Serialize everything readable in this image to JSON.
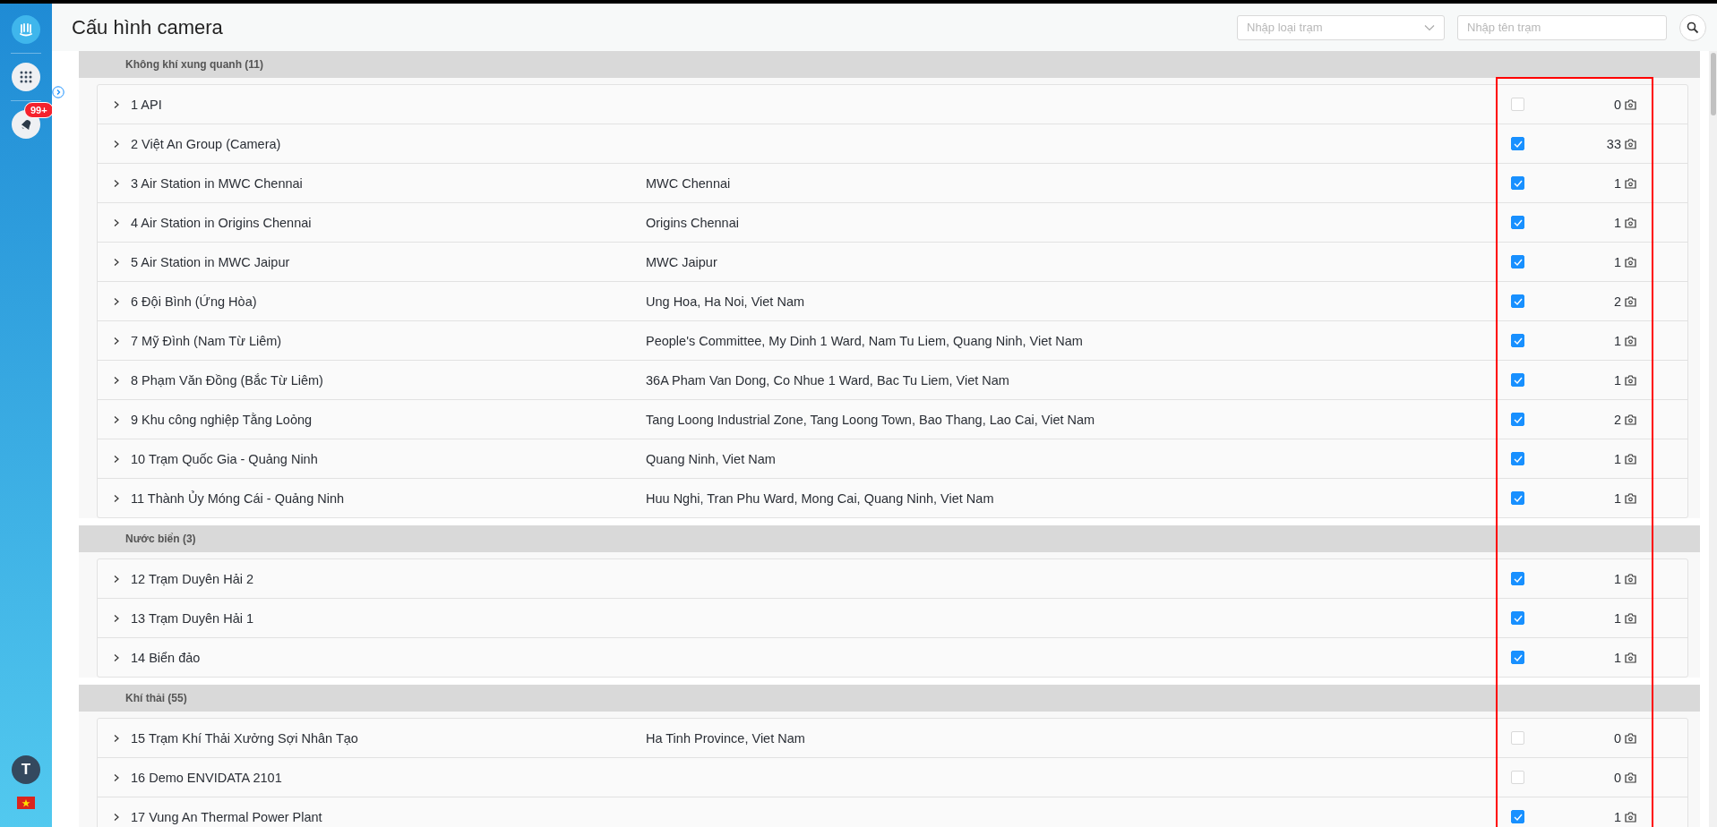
{
  "sidebar": {
    "badge": "99+",
    "avatar": "T"
  },
  "header": {
    "title": "Cấu hình camera",
    "type_select": {
      "placeholder": "Nhập loại trạm"
    },
    "name_search": {
      "placeholder": "Nhập tên trạm"
    }
  },
  "groups": [
    {
      "title": "Không khí xung quanh (11)",
      "rows": [
        {
          "name": "1 API",
          "checked": false,
          "count": "0"
        },
        {
          "name": "2 Việt An Group (Camera)",
          "checked": true,
          "count": "33"
        },
        {
          "name": "3 Air Station in MWC Chennai",
          "address": "MWC Chennai",
          "checked": true,
          "count": "1"
        },
        {
          "name": "4 Air Station in Origins Chennai",
          "address": "Origins Chennai",
          "checked": true,
          "count": "1"
        },
        {
          "name": "5 Air Station in MWC Jaipur",
          "address": "MWC Jaipur",
          "checked": true,
          "count": "1"
        },
        {
          "name": "6 Đội Bình (Ứng Hòa)",
          "address": "Ung Hoa, Ha Noi, Viet Nam",
          "checked": true,
          "count": "2"
        },
        {
          "name": "7 Mỹ Đình (Nam Từ Liêm)",
          "address": "People's Committee, My Dinh 1 Ward, Nam Tu Liem, Quang Ninh, Viet Nam",
          "checked": true,
          "count": "1"
        },
        {
          "name": "8 Phạm Văn Đồng (Bắc Từ Liêm)",
          "address": "36A Pham Van Dong, Co Nhue 1 Ward, Bac Tu Liem, Viet Nam",
          "checked": true,
          "count": "1"
        },
        {
          "name": "9 Khu công nghiệp Tằng Loỏng",
          "address": "Tang Loong Industrial Zone, Tang Loong Town, Bao Thang, Lao Cai, Viet Nam",
          "checked": true,
          "count": "2"
        },
        {
          "name": "10 Trạm Quốc Gia - Quảng Ninh",
          "address": "Quang Ninh, Viet Nam",
          "checked": true,
          "count": "1"
        },
        {
          "name": "11 Thành Ủy Móng Cái - Quảng Ninh",
          "address": "Huu Nghi, Tran Phu Ward, Mong Cai, Quang Ninh, Viet Nam",
          "checked": true,
          "count": "1"
        }
      ]
    },
    {
      "title": "Nước biển (3)",
      "rows": [
        {
          "name": "12 Trạm Duyên Hải 2",
          "checked": true,
          "count": "1"
        },
        {
          "name": "13 Trạm Duyên Hải 1",
          "checked": true,
          "count": "1"
        },
        {
          "name": "14 Biển đảo",
          "checked": true,
          "count": "1"
        }
      ]
    },
    {
      "title": "Khí thải (55)",
      "rows": [
        {
          "name": "15 Trạm Khí Thải Xưởng Sợi Nhân Tạo",
          "address": "Ha Tinh Province, Viet Nam",
          "checked": false,
          "count": "0"
        },
        {
          "name": "16 Demo ENVIDATA 2101",
          "checked": false,
          "count": "0"
        },
        {
          "name": "17 Vung An Thermal Power Plant",
          "checked": true,
          "count": "1"
        }
      ]
    }
  ]
}
